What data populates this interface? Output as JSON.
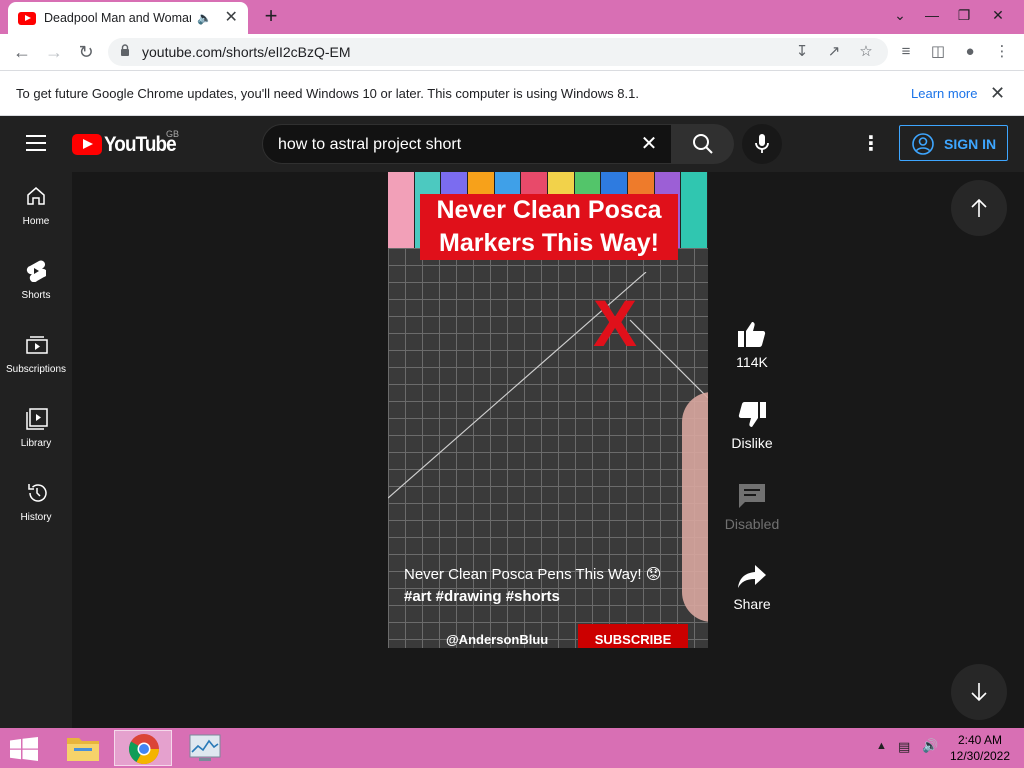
{
  "browser": {
    "tab_title": "Deadpool Man and Woman",
    "url": "youtube.com/shorts/elI2cBzQ-EM"
  },
  "infobar": {
    "message": "To get future Google Chrome updates, you'll need Windows 10 or later. This computer is using Windows 8.1.",
    "learn_more": "Learn more"
  },
  "youtube": {
    "wordmark": "YouTube",
    "country": "GB",
    "search_query": "how to astral project short",
    "sign_in": "SIGN IN"
  },
  "sidebar": {
    "items": [
      {
        "label": "Home"
      },
      {
        "label": "Shorts"
      },
      {
        "label": "Subscriptions"
      },
      {
        "label": "Library"
      },
      {
        "label": "History"
      }
    ]
  },
  "short": {
    "banner_line1": "Never Clean Posca",
    "banner_line2": "Markers This Way!",
    "big_x": "X",
    "description": "Never Clean Posca Pens This Way! 😟",
    "hashtags": "#art #drawing #shorts",
    "channel": "@AndersonBluu",
    "subscribe": "SUBSCRIBE"
  },
  "actions": {
    "likes": "114K",
    "dislike": "Dislike",
    "comments": "Disabled",
    "share": "Share"
  },
  "taskbar": {
    "time": "2:40 AM",
    "date": "12/30/2022"
  },
  "colors": {
    "youtube_red": "#ff0000",
    "chrome_frame": "#d86fb4",
    "link_blue": "#3ea6ff"
  }
}
